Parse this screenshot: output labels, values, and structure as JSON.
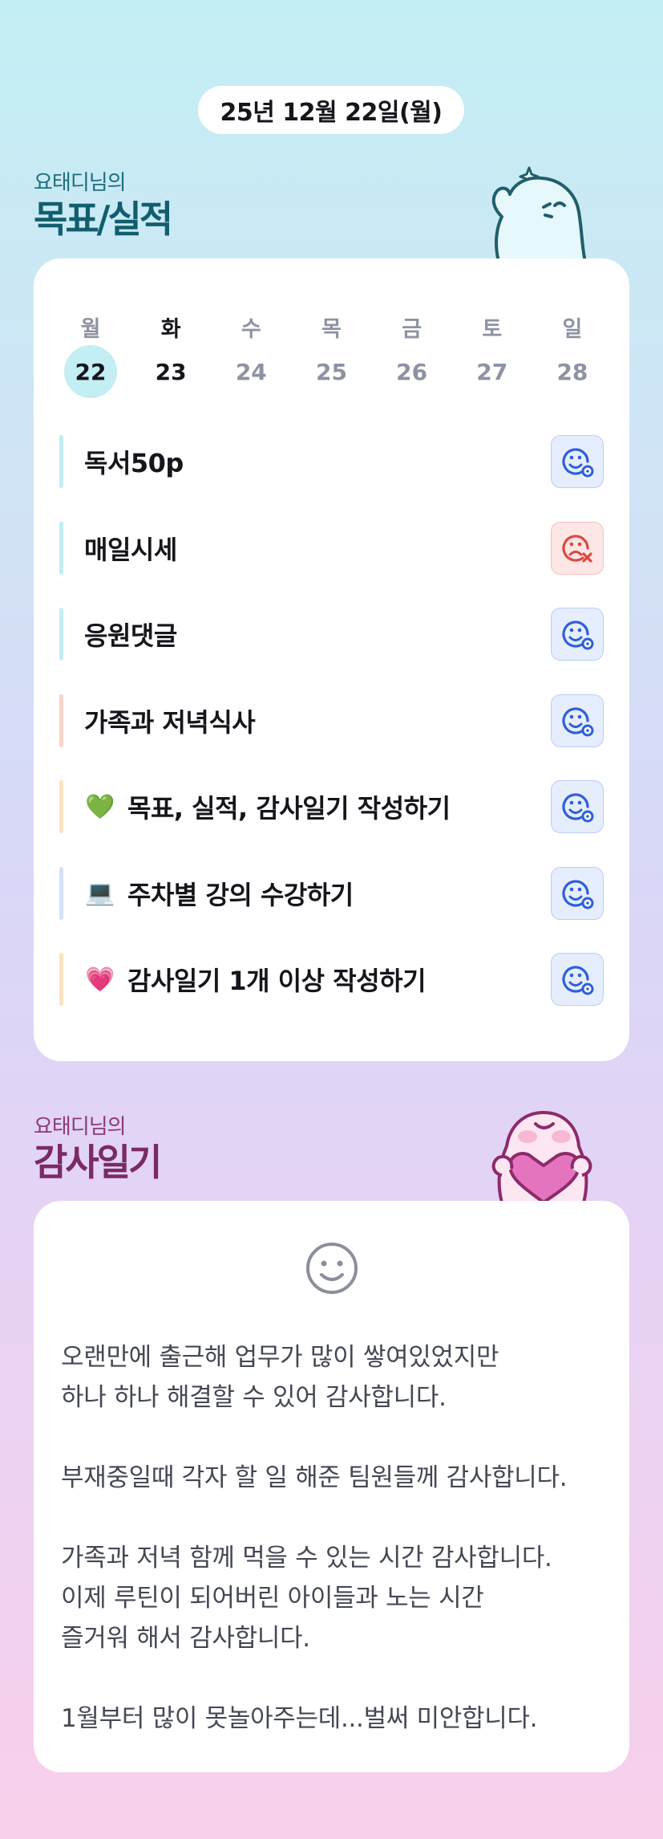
{
  "date_label": "25년 12월 22일(월)",
  "goals_section": {
    "owner_label": "요태디님의",
    "title": "목표/실적"
  },
  "week": {
    "weekdays": [
      "월",
      "화",
      "수",
      "목",
      "금",
      "토",
      "일"
    ],
    "dates": [
      "22",
      "23",
      "24",
      "25",
      "26",
      "27",
      "28"
    ],
    "selected_index": 0,
    "today_index": 1
  },
  "goals": [
    {
      "emoji": "",
      "text": "독서50p",
      "status": "done",
      "bar_color": "#c3eef3"
    },
    {
      "emoji": "",
      "text": "매일시세",
      "status": "fail",
      "bar_color": "#c3eef3"
    },
    {
      "emoji": "",
      "text": "응원댓글",
      "status": "done",
      "bar_color": "#c3eef3"
    },
    {
      "emoji": "",
      "text": "가족과 저녁식사",
      "status": "done",
      "bar_color": "#f9d3c8"
    },
    {
      "emoji": "💚",
      "text": "목표, 실적, 감사일기 작성하기",
      "status": "done",
      "bar_color": "#fbe3c2"
    },
    {
      "emoji": "💻",
      "text": "주차별 강의 수강하기",
      "status": "done",
      "bar_color": "#d4e2f7"
    },
    {
      "emoji": "💗",
      "text": "감사일기 1개 이상 작성하기",
      "status": "done",
      "bar_color": "#fbe3c2"
    }
  ],
  "diary_section": {
    "owner_label": "요태디님의",
    "title": "감사일기"
  },
  "diary": {
    "mood_icon": "smile-face-icon",
    "paragraphs": [
      "오랜만에 출근해 업무가 많이 쌓여있었지만\n하나 하나 해결할 수 있어 감사합니다.",
      "부재중일때 각자 할 일 해준 팀원들께 감사합니다.",
      "가족과 저녁 함께 먹을 수 있는 시간 감사합니다.\n이제 루틴이 되어버린 아이들과 노는 시간\n즐거워 해서 감사합니다.",
      "1월부터 많이 못놀아주는데...벌써 미안합니다."
    ]
  },
  "colors": {
    "done_icon": "#2d5fd8",
    "fail_icon": "#e0473c",
    "goal_title": "#135e6e",
    "diary_title": "#7a2a66"
  }
}
